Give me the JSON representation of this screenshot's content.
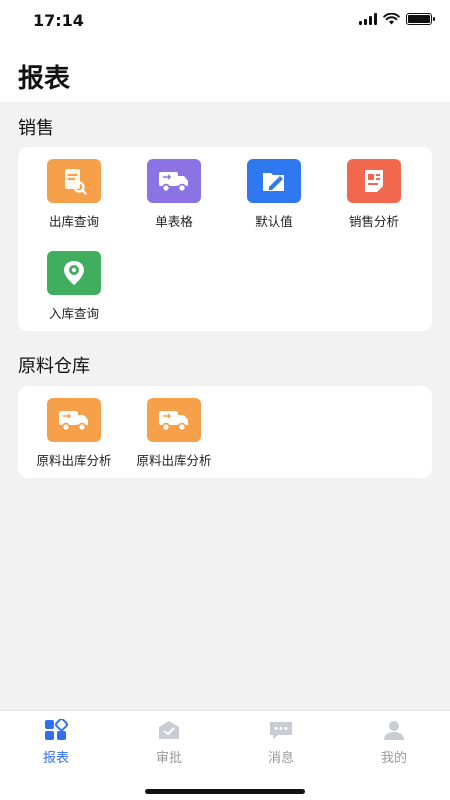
{
  "status_bar": {
    "time": "17:14",
    "battery_level": 1.0
  },
  "header": {
    "title": "报表"
  },
  "sections": [
    {
      "title": "销售",
      "items": [
        {
          "label": "出库查询",
          "icon": "document-search-icon",
          "color": "#f7a04a"
        },
        {
          "label": "单表格",
          "icon": "delivery-truck-icon",
          "color": "#8b73e3"
        },
        {
          "label": "默认值",
          "icon": "folder-edit-icon",
          "color": "#2f78f0"
        },
        {
          "label": "销售分析",
          "icon": "report-sheet-icon",
          "color": "#f2684f"
        },
        {
          "label": "入库查询",
          "icon": "location-pin-icon",
          "color": "#3fae5e"
        }
      ]
    },
    {
      "title": "原料仓库",
      "items": [
        {
          "label": "原料出库分析",
          "icon": "delivery-truck-icon",
          "color": "#f7a04a"
        },
        {
          "label": "原料出库分析",
          "icon": "delivery-truck-icon",
          "color": "#f7a04a"
        }
      ]
    }
  ],
  "tabs": [
    {
      "label": "报表",
      "icon": "grid-icon",
      "active": true
    },
    {
      "label": "审批",
      "icon": "inbox-icon",
      "active": false
    },
    {
      "label": "消息",
      "icon": "chat-icon",
      "active": false
    },
    {
      "label": "我的",
      "icon": "person-icon",
      "active": false
    }
  ],
  "colors": {
    "accent": "#2f6ff0",
    "inactive_tab": "#c9ccd3",
    "background": "#f2f2f2"
  }
}
